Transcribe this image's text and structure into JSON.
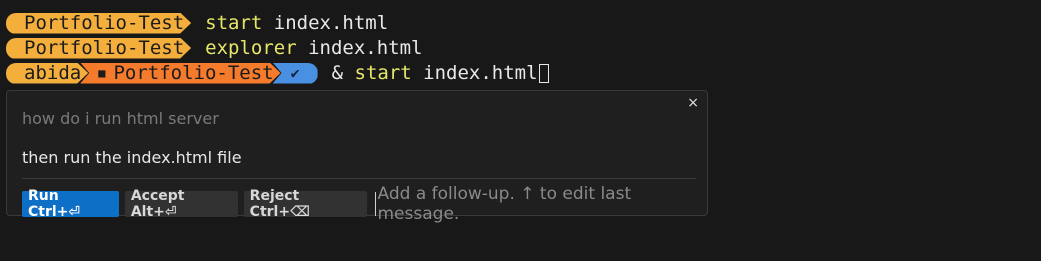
{
  "terminal": {
    "lines": [
      {
        "prompt": "Portfolio-Test",
        "command": "start",
        "arg": " index.html"
      },
      {
        "prompt": "Portfolio-Test",
        "command": "explorer",
        "arg": " index.html"
      }
    ],
    "current": {
      "user": "abida",
      "folder": "Portfolio-Test",
      "status_icon": "✔",
      "amp": "& ",
      "command": "start",
      "arg": " index.html"
    }
  },
  "chat": {
    "previous_prompt": "how do i run html server",
    "response": "then run the index.html file",
    "buttons": {
      "run": "Run Ctrl+⏎",
      "accept": "Accept Alt+⏎",
      "reject": "Reject Ctrl+⌫"
    },
    "followup_placeholder": "Add a follow-up. ↑ to edit last message.",
    "close_icon": "×"
  },
  "colors": {
    "yellow": "#f4ae3b",
    "orange": "#f47a2c",
    "blue": "#4a90e2",
    "primary_button": "#0e6fc7"
  }
}
